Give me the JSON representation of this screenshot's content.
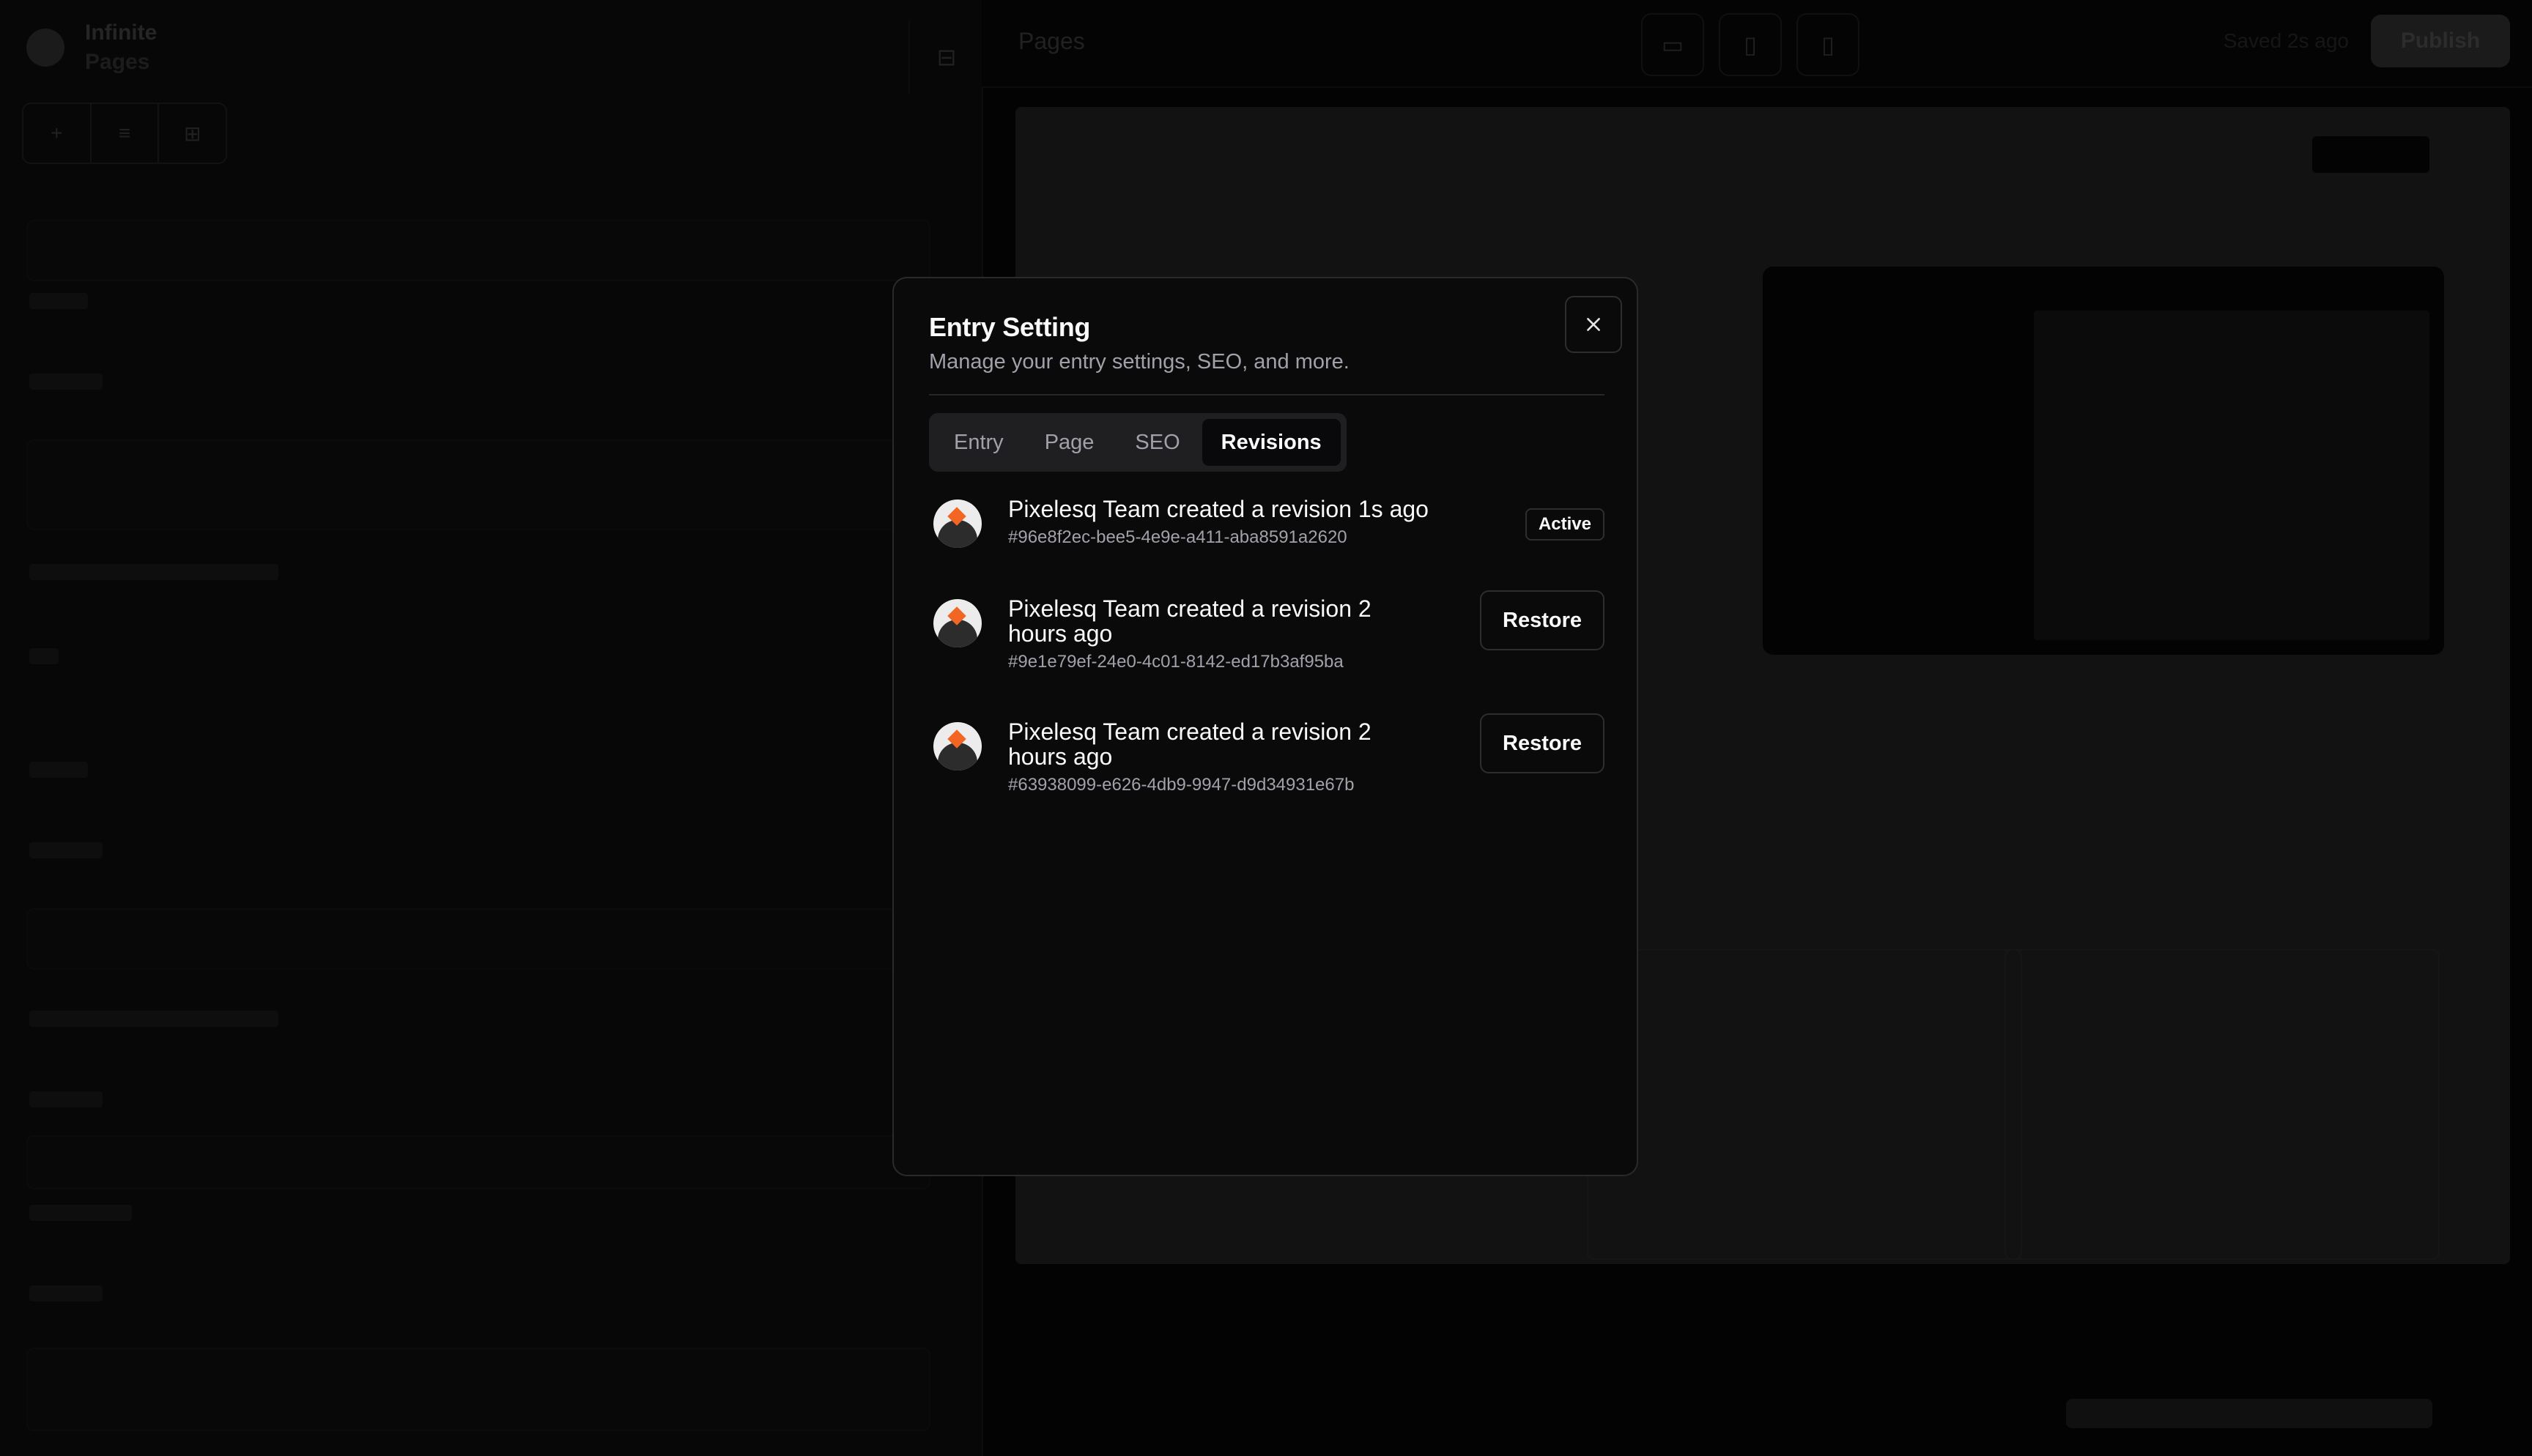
{
  "background": {
    "brand_line1": "Infinite",
    "brand_line2": "Pages",
    "pages_crumb": "Pages",
    "publish_label": "Publish",
    "saved_label": "Saved 2s ago"
  },
  "modal": {
    "title": "Entry Setting",
    "description": "Manage your entry settings, SEO, and more.",
    "tabs": [
      {
        "label": "Entry",
        "active": false
      },
      {
        "label": "Page",
        "active": false
      },
      {
        "label": "SEO",
        "active": false
      },
      {
        "label": "Revisions",
        "active": true
      }
    ],
    "revisions": [
      {
        "title": "Pixelesq Team created a revision 1s ago",
        "id": "#96e8f2ec-bee5-4e9e-a411-aba8591a2620",
        "status": "Active"
      },
      {
        "title": "Pixelesq Team created a revision 2 hours ago",
        "id": "#9e1e79ef-24e0-4c01-8142-ed17b3af95ba",
        "action": "Restore"
      },
      {
        "title": "Pixelesq Team created a revision 2 hours ago",
        "id": "#63938099-e626-4db9-9947-d9d34931e67b",
        "action": "Restore"
      }
    ]
  },
  "colors": {
    "modal_bg": "#0a0a0b",
    "text_primary": "#fafafa",
    "text_muted": "#a1a1aa",
    "accent": "#f26522"
  }
}
